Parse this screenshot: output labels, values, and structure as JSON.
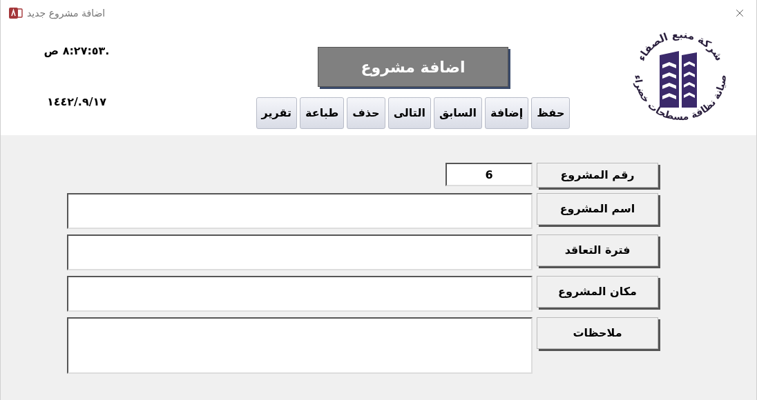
{
  "window": {
    "title": "اضافة مشروع جديد"
  },
  "header": {
    "time": ".٨:٢٧:٥٣ ص",
    "date": "١٤٤٢/.٩/١٧",
    "title": "اضافة مشروع",
    "logo": {
      "top_text": "شركة منبع الصفاء",
      "bottom_text": "صيانة نظافة مسطحات خضراء"
    },
    "buttons": [
      "حفظ",
      "إضافة",
      "السابق",
      "التالى",
      "حذف",
      "طباعة",
      "تقرير"
    ]
  },
  "form": {
    "fields": [
      {
        "kind": "short",
        "label": "رقم المشروع",
        "value": "6"
      },
      {
        "kind": "line",
        "label": "اسم المشروع"
      },
      {
        "kind": "line",
        "label": "فترة التعاقد"
      },
      {
        "kind": "line",
        "label": "مكان المشروع"
      },
      {
        "kind": "multiline",
        "label": "ملاحظات"
      }
    ]
  }
}
